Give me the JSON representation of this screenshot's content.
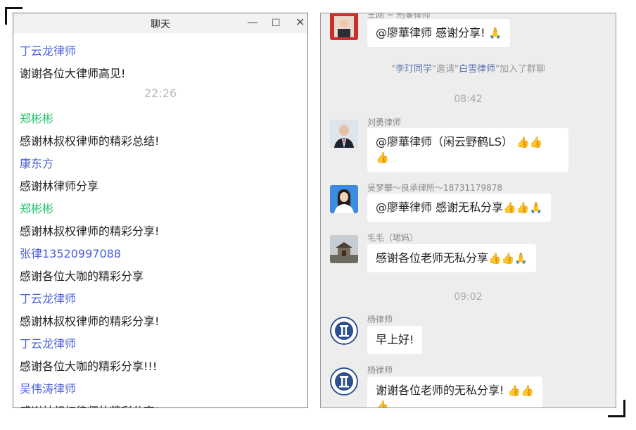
{
  "left_window": {
    "title": "聊天",
    "controls": {
      "minimize": "—",
      "maximize": "☐",
      "close": "✕"
    },
    "items": [
      {
        "kind": "sender",
        "text": "丁云龙律师",
        "color": "#4a5fd7"
      },
      {
        "kind": "text",
        "text": "谢谢各位大律师高见!"
      },
      {
        "kind": "time",
        "text": "22:26"
      },
      {
        "kind": "sender",
        "text": "郑彬彬",
        "color": "#22c06b"
      },
      {
        "kind": "text",
        "text": "感谢林叔权律师的精彩总结!"
      },
      {
        "kind": "sender",
        "text": "康东方",
        "color": "#4a5fd7"
      },
      {
        "kind": "text",
        "text": "感谢林律师分享"
      },
      {
        "kind": "sender",
        "text": "郑彬彬",
        "color": "#22c06b"
      },
      {
        "kind": "text",
        "text": "感谢林叔权律师的精彩分享!"
      },
      {
        "kind": "sender",
        "text": "张律13520997088",
        "color": "#4a5fd7"
      },
      {
        "kind": "text",
        "text": "感谢各位大咖的精彩分享"
      },
      {
        "kind": "sender",
        "text": "丁云龙律师",
        "color": "#4a5fd7"
      },
      {
        "kind": "text",
        "text": "感谢林叔权律师的精彩分享!"
      },
      {
        "kind": "sender",
        "text": "丁云龙律师",
        "color": "#4a5fd7"
      },
      {
        "kind": "text",
        "text": "感谢各位大咖的精彩分享!!!"
      },
      {
        "kind": "sender",
        "text": "吴伟涛律师",
        "color": "#4a5fd7"
      },
      {
        "kind": "text",
        "text": "感谢林叔权律师的精彩分享!"
      }
    ]
  },
  "right_window": {
    "top_nick": "王刚 ~ 刑事律师",
    "msg1": {
      "text": "@廖華律师 感谢分享!",
      "emoji": "🙏"
    },
    "system": {
      "q1": "\"",
      "inviter": "李玎同学",
      "mid": "\"邀请\"",
      "invitee": "白雪律师",
      "tail": "\"加入了群聊"
    },
    "time1": "08:42",
    "msg2": {
      "nick": "刘勇律师",
      "text": "@廖華律师（闲云野鹤LS）",
      "emoji1": "👍👍",
      "emoji2": "👍"
    },
    "msg3": {
      "nick": "吴梦攀～良承律所～18731179878",
      "text": "@廖華律师 感谢无私分享",
      "emoji": "👍👍🙏"
    },
    "msg4": {
      "nick": "毛毛（珺妈）",
      "text": "感谢各位老师无私分享",
      "emoji": "👍👍🙏"
    },
    "time2": "09:02",
    "msg5": {
      "nick": "杨律师",
      "text": "早上好!"
    },
    "msg6": {
      "nick": "杨律师",
      "text": "谢谢各位老师的无私分享!",
      "emoji1": "👍👍",
      "emoji2": "👍"
    },
    "colors": {
      "background": "#ededed",
      "bubble": "#ffffff",
      "highlight": "#5b78b5"
    }
  }
}
